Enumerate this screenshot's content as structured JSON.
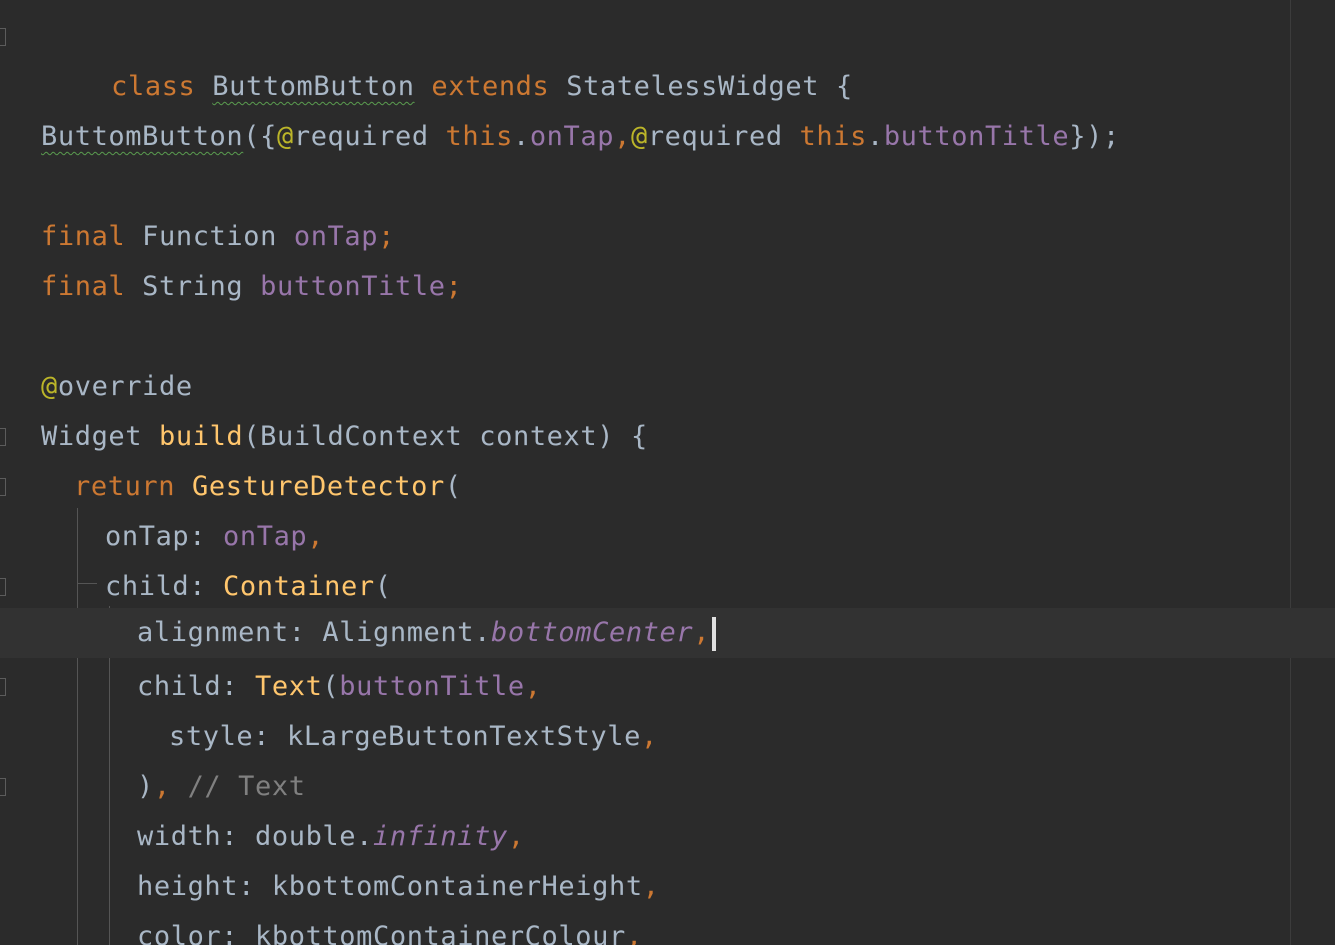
{
  "editor": {
    "colors": {
      "background": "#2b2b2b",
      "keyword": "#cc7832",
      "function": "#ffc66d",
      "field": "#9876aa",
      "annotation": "#bbb529",
      "comment": "#808080",
      "plain": "#a9b7c6",
      "current_line": "#323232"
    },
    "lines": {
      "l1": {
        "kw_class": "class",
        "name": "ButtomButton",
        "kw_extends": "extends",
        "super": "StatelessWidget",
        "brace": "{"
      },
      "l3": {
        "ctor": "ButtomButton",
        "open": "({",
        "at1": "@",
        "req1": "required",
        "this1": "this",
        "dot1": ".",
        "p1": "onTap",
        "comma1": ",",
        "at2": "@",
        "req2": "required",
        "this2": "this",
        "dot2": ".",
        "p2": "buttonTitle",
        "close": "});"
      },
      "l5": {
        "kw": "final",
        "type": "Function",
        "name": "onTap",
        "semi": ";"
      },
      "l6": {
        "kw": "final",
        "type": "String",
        "name": "buttonTitle",
        "semi": ";"
      },
      "l8": {
        "at": "@",
        "name": "override"
      },
      "l9": {
        "type": "Widget",
        "fn": "build",
        "open": "(",
        "ptype": "BuildContext",
        "pname": "context",
        "close": ") {"
      },
      "l10": {
        "kw": "return",
        "cls": "GestureDetector",
        "open": "("
      },
      "l11": {
        "label": "onTap:",
        "value": "onTap",
        "comma": ","
      },
      "l12": {
        "label": "child:",
        "cls": "Container",
        "open": "("
      },
      "l13": {
        "label": "alignment:",
        "cls": "Alignment",
        "dot": ".",
        "value": "bottomCenter",
        "comma": ","
      },
      "l14": {
        "label": "child:",
        "cls": "Text",
        "open": "(",
        "value": "buttonTitle",
        "comma": ","
      },
      "l15": {
        "label": "style:",
        "value": "kLargeButtonTextStyle",
        "comma": ","
      },
      "l16": {
        "close": ")",
        "comma": ",",
        "comment": "// Text"
      },
      "l17": {
        "label": "width:",
        "type": "double",
        "dot": ".",
        "value": "infinity",
        "comma": ","
      },
      "l18": {
        "label": "height:",
        "value": "kbottomContainerHeight",
        "comma": ","
      },
      "l19": {
        "label": "color:",
        "value": "kbottomContainerColour",
        "comma": ","
      }
    }
  }
}
